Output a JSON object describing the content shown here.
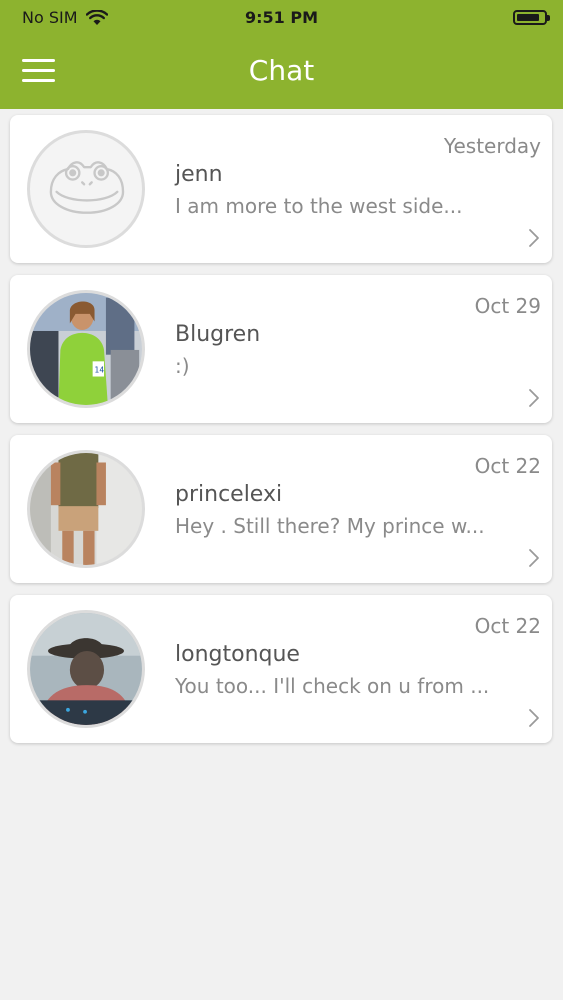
{
  "status_bar": {
    "carrier": "No SIM",
    "time": "9:51 PM",
    "battery_level": 0.85
  },
  "header": {
    "title": "Chat",
    "menu_icon": "hamburger-menu-icon",
    "background": "#8db32f"
  },
  "chats": [
    {
      "name": "jenn",
      "preview": "I am more to the west side...",
      "date": "Yesterday",
      "avatar": "default-frog-avatar"
    },
    {
      "name": "Blugren",
      "preview": ":)",
      "date": "Oct 29",
      "avatar": "user-photo"
    },
    {
      "name": "princelexi",
      "preview": "Hey . Still there? My prince w...",
      "date": "Oct 22",
      "avatar": "user-photo"
    },
    {
      "name": "longtonque",
      "preview": "You too... I'll check on u from ...",
      "date": "Oct 22",
      "avatar": "user-photo"
    }
  ]
}
